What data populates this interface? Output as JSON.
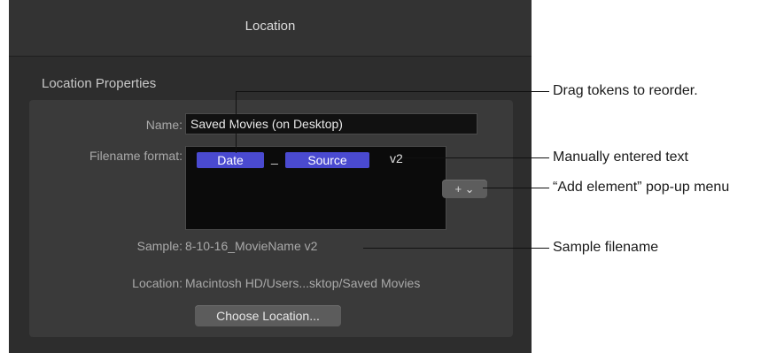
{
  "window": {
    "title": "Location"
  },
  "section": {
    "label": "Location Properties"
  },
  "fields": {
    "name_label": "Name:",
    "name_value": "Saved Movies (on Desktop)",
    "format_label": "Filename format:",
    "tokens": [
      "Date",
      "Source"
    ],
    "separator": "_",
    "manual_text": "v2",
    "add_menu_glyph": "+ ⌄",
    "sample_label": "Sample:",
    "sample_value": "8-10-16_MovieName v2",
    "location_label": "Location:",
    "location_value": "Macintosh HD/Users...sktop/Saved Movies",
    "choose_button": "Choose Location..."
  },
  "callouts": {
    "drag": "Drag tokens to reorder.",
    "manual": "Manually entered text",
    "add_menu": "“Add element” pop-up menu",
    "sample": "Sample filename"
  },
  "colors": {
    "panel_bg": "#2d2d2d",
    "token_bg": "#4a4ad0",
    "field_bg": "#111111"
  }
}
